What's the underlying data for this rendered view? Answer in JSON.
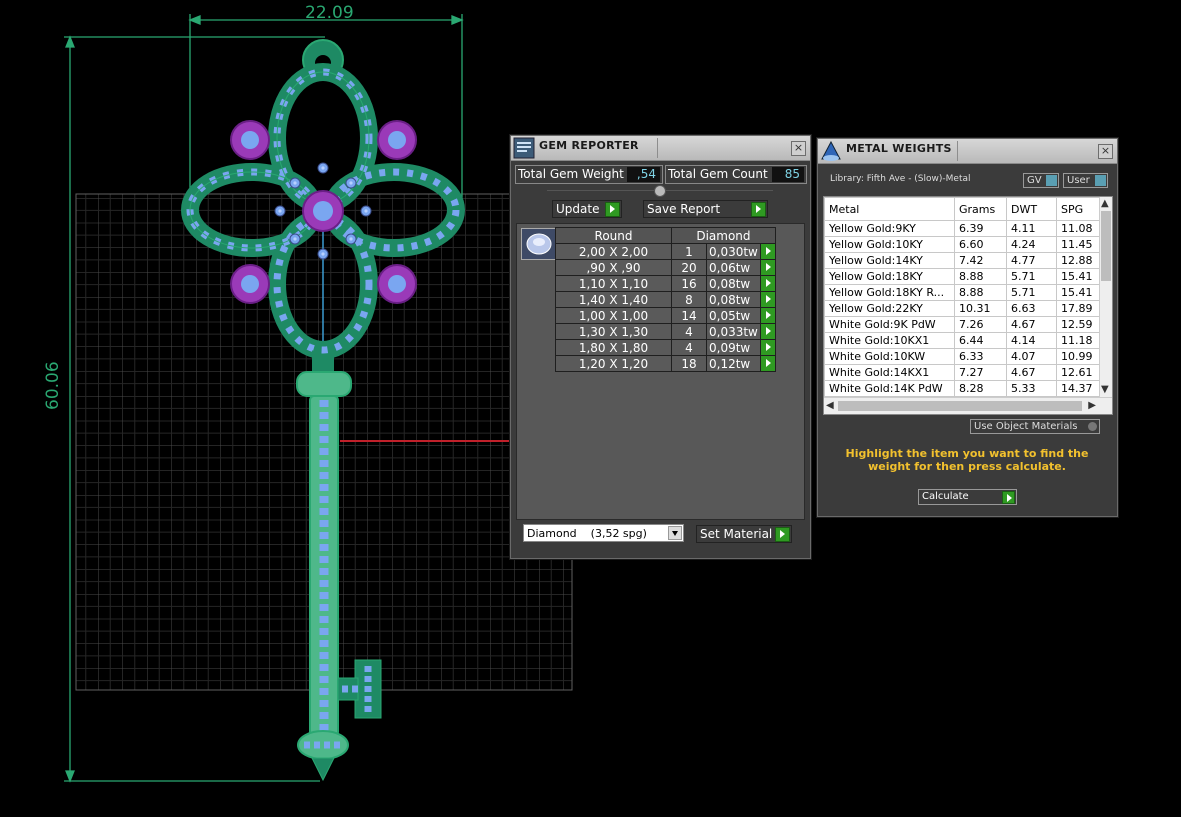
{
  "dimensions": {
    "width_label": "22.09",
    "height_label": "60.06"
  },
  "gem_reporter": {
    "title": "GEM REPORTER",
    "total_gem_weight_label": "Total Gem Weight",
    "total_gem_weight_value": ",54",
    "total_gem_count_label": "Total Gem Count",
    "total_gem_count_value": "85",
    "update_label": "Update",
    "save_report_label": "Save Report",
    "table_headers": {
      "shape": "Round",
      "material": "Diamond"
    },
    "rows": [
      {
        "size": "2,00 X 2,00",
        "count": "1",
        "weight": "0,030tw"
      },
      {
        "size": ",90 X ,90",
        "count": "20",
        "weight": "0,06tw"
      },
      {
        "size": "1,10 X 1,10",
        "count": "16",
        "weight": "0,08tw"
      },
      {
        "size": "1,40 X 1,40",
        "count": "8",
        "weight": "0,08tw"
      },
      {
        "size": "1,00 X 1,00",
        "count": "14",
        "weight": "0,05tw"
      },
      {
        "size": "1,30 X 1,30",
        "count": "4",
        "weight": "0,033tw"
      },
      {
        "size": "1,80 X 1,80",
        "count": "4",
        "weight": "0,09tw"
      },
      {
        "size": "1,20 X 1,20",
        "count": "18",
        "weight": "0,12tw"
      }
    ],
    "material_select_value": "Diamond    (3,52 spg)",
    "set_material_label": "Set Material"
  },
  "metal_weights": {
    "title": "METAL WEIGHTS",
    "library_label": "Library: Fifth Ave - (Slow)-Metal",
    "gv_label": "GV",
    "user_label": "User",
    "columns": [
      "Metal",
      "Grams",
      "DWT",
      "SPG"
    ],
    "rows": [
      [
        "Yellow Gold:9KY",
        "6.39",
        "4.11",
        "11.08"
      ],
      [
        "Yellow Gold:10KY",
        "6.60",
        "4.24",
        "11.45"
      ],
      [
        "Yellow Gold:14KY",
        "7.42",
        "4.77",
        "12.88"
      ],
      [
        "Yellow Gold:18KY",
        "8.88",
        "5.71",
        "15.41"
      ],
      [
        "Yellow Gold:18KY R...",
        "8.88",
        "5.71",
        "15.41"
      ],
      [
        "Yellow Gold:22KY",
        "10.31",
        "6.63",
        "17.89"
      ],
      [
        "White Gold:9K PdW",
        "7.26",
        "4.67",
        "12.59"
      ],
      [
        "White Gold:10KX1",
        "6.44",
        "4.14",
        "11.18"
      ],
      [
        "White Gold:10KW",
        "6.33",
        "4.07",
        "10.99"
      ],
      [
        "White Gold:14KX1",
        "7.27",
        "4.67",
        "12.61"
      ],
      [
        "White Gold:14K PdW",
        "8.28",
        "5.33",
        "14.37"
      ]
    ],
    "use_object_materials_label": "Use Object Materials",
    "instruction": "Highlight the item you want to find the weight for then press calculate.",
    "calculate_label": "Calculate"
  },
  "colors": {
    "background": "#000000",
    "dimension": "#2aa872",
    "jewel_metal": "#1e8a64",
    "gem_light": "#7aa6f0",
    "gem_purple": "#9a3ab8",
    "accent_text": "#f2c12e",
    "go_button": "#2f9a22"
  }
}
